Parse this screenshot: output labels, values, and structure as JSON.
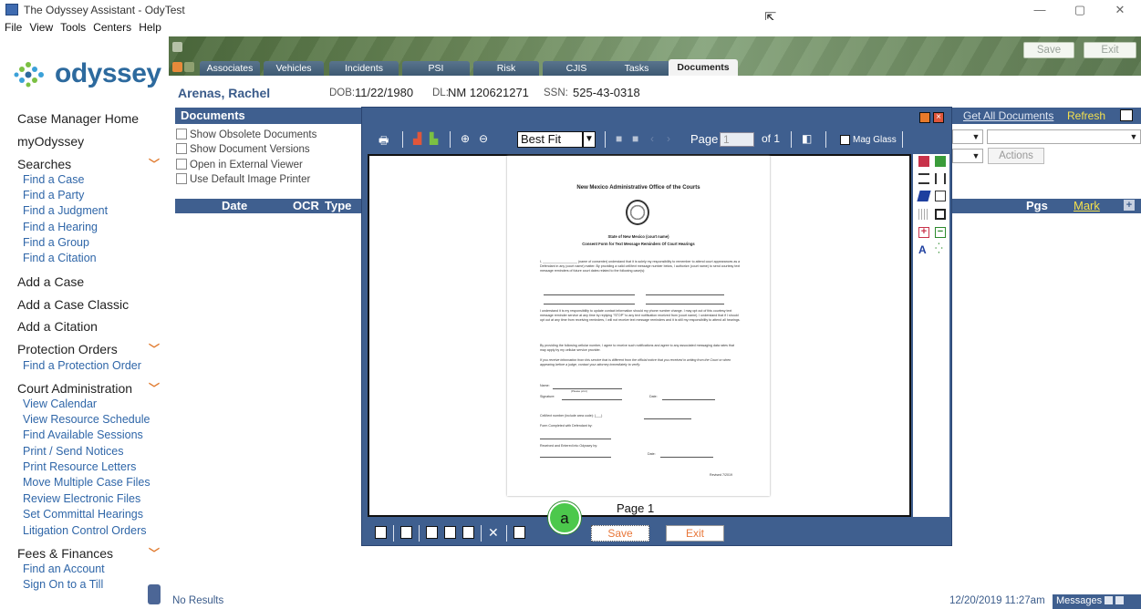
{
  "window": {
    "title": "The Odyssey Assistant - OdyTest",
    "controls": [
      "—",
      "▢",
      "✕"
    ]
  },
  "menu": [
    "File",
    "View",
    "Tools",
    "Centers",
    "Help"
  ],
  "logo": {
    "text": "odyssey"
  },
  "nav": {
    "sections": [
      {
        "label": "Case Manager Home",
        "items": []
      },
      {
        "label": "myOdyssey",
        "items": []
      },
      {
        "label": "Searches",
        "items": [
          "Find a Case",
          "Find a Party",
          "Find a Judgment",
          "Find a Hearing",
          "Find a Group",
          "Find a Citation"
        ]
      },
      {
        "label": "Add a Case",
        "items": []
      },
      {
        "label": "Add a Case Classic",
        "items": []
      },
      {
        "label": "Add a Citation",
        "items": []
      },
      {
        "label": "Protection Orders",
        "items": [
          "Find a Protection Order"
        ]
      },
      {
        "label": "Court Administration",
        "items": [
          "View Calendar",
          "View Resource Schedule",
          "Find Available Sessions",
          "Print / Send Notices",
          "Print Resource Letters",
          "Move Multiple Case Files",
          "Review Electronic Files",
          "Set Committal Hearings",
          "Litigation Control Orders"
        ]
      },
      {
        "label": "Fees & Finances",
        "items": [
          "Find an Account",
          "Sign On to a Till"
        ]
      }
    ]
  },
  "header": {
    "save": "Save",
    "exit": "Exit",
    "tabs": [
      "Associates",
      "Vehicles",
      "Incidents",
      "PSI",
      "Risk",
      "CJIS",
      "Tasks",
      "Documents"
    ],
    "active_tab": "Documents"
  },
  "party": {
    "name": "Arenas, Rachel",
    "dob_label": "DOB:",
    "dob": "11/22/1980",
    "dl_label": "DL:",
    "dl": "NM 120621271",
    "ssn_label": "SSN:",
    "ssn": "525-43-0318"
  },
  "documents": {
    "title": "Documents",
    "get_all": "Get All Documents",
    "refresh": "Refresh",
    "options": [
      "Show Obsolete Documents",
      "Show Document Versions",
      "Open in External Viewer",
      "Use Default Image Printer"
    ],
    "actions": "Actions",
    "columns": {
      "date": "Date",
      "ocr": "OCR",
      "type": "Type",
      "pgs": "Pgs",
      "mark": "Mark"
    }
  },
  "status": {
    "left": "No Results",
    "time": "12/20/2019 11:27am",
    "messages": "Messages"
  },
  "viewer": {
    "fit": "Best Fit",
    "page_label": "Page",
    "page_value": "1",
    "of_label": "of 1",
    "mag_glass": "Mag Glass",
    "caption": "Page 1",
    "save": "Save",
    "exit": "Exit",
    "badge": "a"
  },
  "doc": {
    "heading": "New Mexico Administrative Office of the Courts",
    "state": "State of New Mexico (court name)",
    "form_title": "Consent Form for Text Message Reminders Of Court Hearings",
    "para1": "I, ___________________ (name of consenter) understand that it is solely my responsibility to remember to attend court appearances as a Defendant in any (court name) matter. By providing a valid cell/text message number below, I authorize (court name) to send courtesy text message reminders of future court dates related to the following case(s):",
    "para2": "I understand it is my responsibility to update contact information should my phone number change. I may opt out of this courtesy text message reminder service at any time by replying \"STOP\" to any text notification received from (court name). I understand that if I should opt out at any time from receiving reminders, I will not receive text message reminders and it is still my responsibility to attend all hearings.",
    "para3": "By providing the following cellular number, I agree to receive such notifications and agree to any associated messaging data rates that may apply by my cellular service provider.",
    "para4": "If you receive information from this service that is different from the official notice that you received in writing from the Court or when appearing before a judge, contact your attorney immediately to verify.",
    "name_label": "Name:",
    "print_label": "(Please print)",
    "signature_label": "Signature:",
    "date_label": "Date:",
    "cell_label": "Cell/text number (include area code): (___)",
    "completed_label": "Form Completed with Defendant by:",
    "received_label": "Received and Entered into Odyssey by:",
    "revised": "Revised 7/2019"
  },
  "colors": {
    "accent": "#3f5f8f",
    "link": "#2f66a8",
    "orange": "#e8773a",
    "badge": "#4cc84c"
  }
}
